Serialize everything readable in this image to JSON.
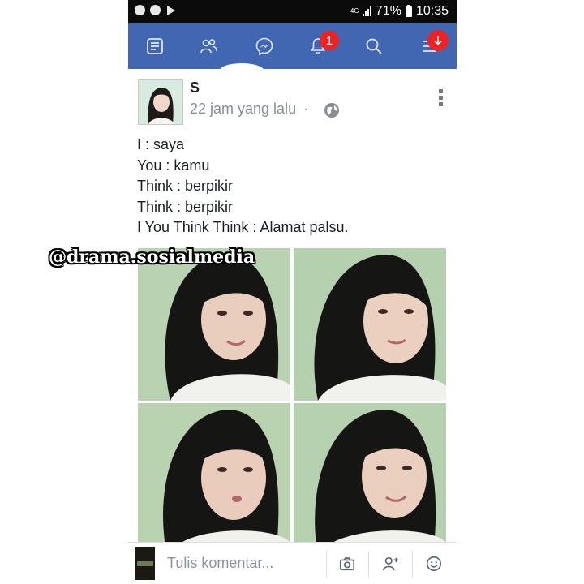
{
  "status_bar": {
    "network": "4G",
    "battery": "71%",
    "time": "10:35"
  },
  "nav": {
    "items": [
      "news-feed-icon",
      "friends-icon",
      "messenger-icon",
      "notifications-icon",
      "search-icon",
      "menu-icon"
    ],
    "notification_count": "1",
    "accent_color": "#4267b2",
    "badge_color": "#ee2222"
  },
  "post": {
    "author": "S",
    "time": "22 jam yang lalu",
    "separator": "·",
    "lines": [
      "I : saya",
      "You : kamu",
      "Think : berpikir",
      "Think : berpikir",
      "I You Think Think : Alamat palsu."
    ]
  },
  "watermark": "@drama.sosialmedia",
  "comment": {
    "placeholder": "Tulis komentar..."
  }
}
